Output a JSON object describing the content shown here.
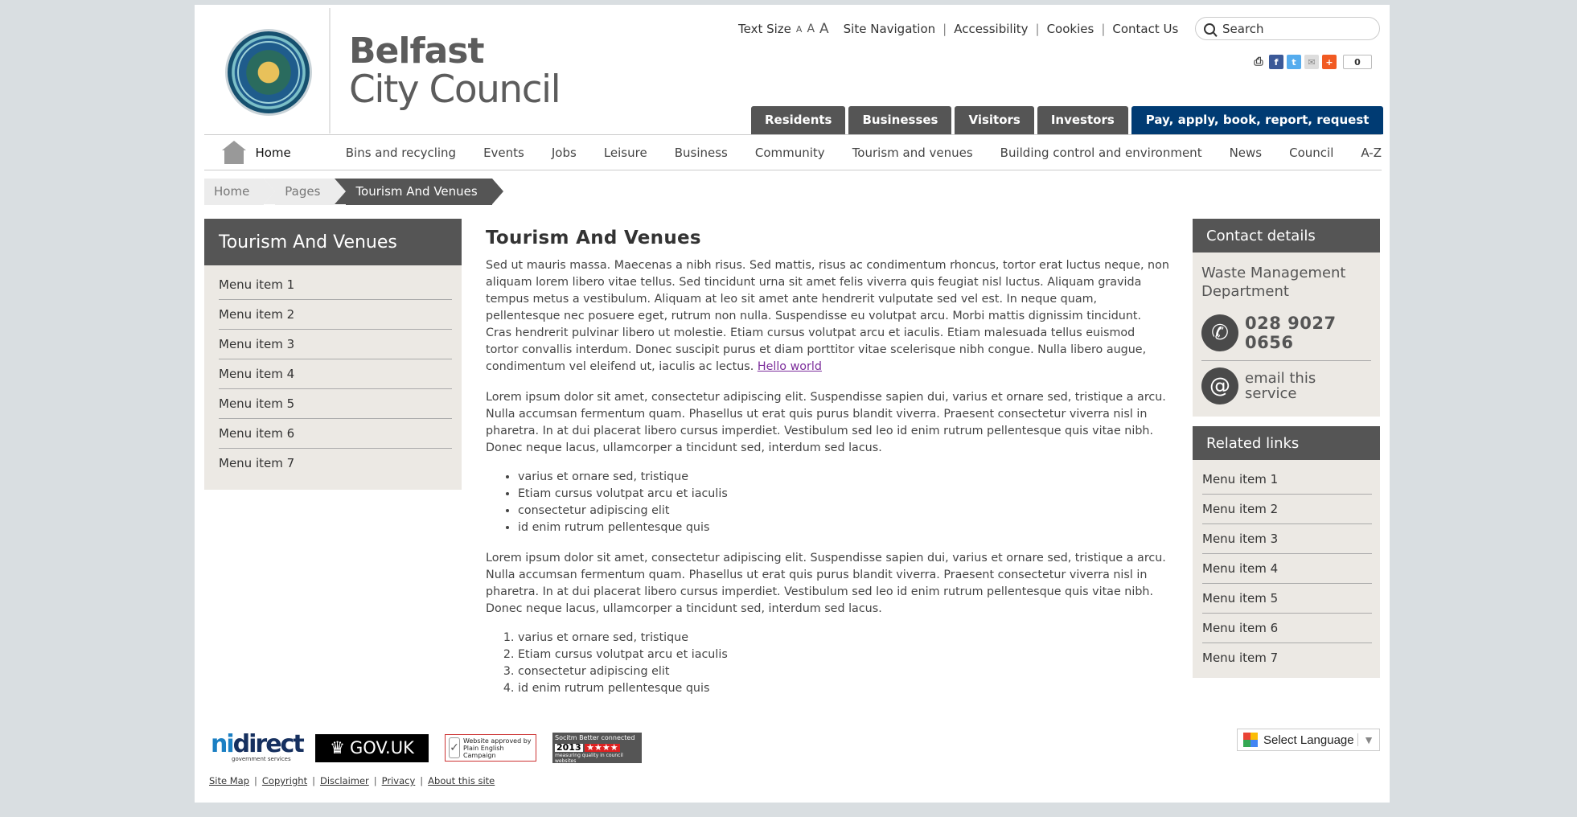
{
  "header": {
    "logo_line1": "Belfast",
    "logo_line2": "City Council",
    "text_size_label": "Text Size",
    "text_size_small": "A",
    "text_size_medium": "A",
    "text_size_large": "A",
    "utility_links": [
      "Site Navigation",
      "Accessibility",
      "Cookies",
      "Contact Us"
    ],
    "search_placeholder": "Search",
    "share_count": "0"
  },
  "audience_tabs": [
    "Residents",
    "Businesses",
    "Visitors",
    "Investors"
  ],
  "pay_tab": "Pay, apply, book, report, request",
  "main_nav": [
    "Home",
    "Bins and recycling",
    "Events",
    "Jobs",
    "Leisure",
    "Business",
    "Community",
    "Tourism and venues",
    "Building control and environment",
    "News",
    "Council",
    "A-Z"
  ],
  "breadcrumb": [
    "Home",
    "Pages",
    "Tourism And Venues"
  ],
  "left_nav": {
    "title": "Tourism And Venues",
    "items": [
      "Menu item 1",
      "Menu item 2",
      "Menu item 3",
      "Menu item 4",
      "Menu item 5",
      "Menu item 6",
      "Menu item 7"
    ]
  },
  "content": {
    "title": "Tourism And Venues",
    "p1": "Sed ut mauris massa. Maecenas a nibh risus. Sed mattis, risus ac condimentum rhoncus, tortor erat luctus neque, non aliquam lorem libero vitae tellus. Sed tincidunt urna sit amet felis viverra quis feugiat nisl luctus. Aliquam gravida tempus metus a vestibulum. Aliquam at leo sit amet ante hendrerit vulputate sed vel est. In neque quam, pellentesque nec posuere eget, rutrum non nulla. Suspendisse eu volutpat arcu. Morbi mattis dignissim tincidunt. Cras hendrerit pulvinar libero ut molestie. Etiam cursus volutpat arcu et iaculis. Etiam malesuada tellus euismod tortor convallis interdum. Donec suscipit purus et diam porttitor vitae scelerisque nibh congue. Nulla libero augue, condimentum vel eleifend ut, iaculis ac lectus.",
    "p1_link": "Hello world",
    "p2": "Lorem ipsum dolor sit amet, consectetur adipiscing elit. Suspendisse sapien dui, varius et ornare sed, tristique a arcu. Nulla accumsan fermentum quam. Phasellus ut erat quis purus blandit viverra. Praesent consectetur viverra nisl in pharetra. In at dui placerat libero cursus imperdiet. Vestibulum sed leo id enim rutrum pellentesque quis vitae nibh. Donec neque lacus, ullamcorper a tincidunt sed, interdum sed lacus.",
    "bullets": [
      "varius et ornare sed, tristique",
      "Etiam cursus volutpat arcu et iaculis",
      "consectetur adipiscing elit",
      "id enim rutrum pellentesque quis"
    ],
    "p3": "Lorem ipsum dolor sit amet, consectetur adipiscing elit. Suspendisse sapien dui, varius et ornare sed, tristique a arcu. Nulla accumsan fermentum quam. Phasellus ut erat quis purus blandit viverra. Praesent consectetur viverra nisl in pharetra. In at dui placerat libero cursus imperdiet. Vestibulum sed leo id enim rutrum pellentesque quis vitae nibh. Donec neque lacus, ullamcorper a tincidunt sed, interdum sed lacus.",
    "numbered": [
      "varius et ornare sed, tristique",
      "Etiam cursus volutpat arcu et iaculis",
      "consectetur adipiscing elit",
      "id enim rutrum pellentesque quis"
    ]
  },
  "contact": {
    "title": "Contact details",
    "department": "Waste Management Department",
    "phone": "028 9027 0656",
    "email_text": "email this service"
  },
  "related": {
    "title": "Related links",
    "items": [
      "Menu item 1",
      "Menu item 2",
      "Menu item 3",
      "Menu item 4",
      "Menu item 5",
      "Menu item 6",
      "Menu item 7"
    ]
  },
  "footer": {
    "nidirect_ni": "ni",
    "nidirect_rest": "direct",
    "nidirect_sub": "government services",
    "govuk": "GOV.UK",
    "plain_english": "Website approved by Plain English Campaign",
    "socitm_title": "Socitm Better connected",
    "socitm_year": "2013",
    "socitm_sub": "measuring quality in council websites",
    "language": "Select Language",
    "links": [
      "Site Map",
      "Copyright",
      "Disclaimer",
      "Privacy",
      "About this site"
    ]
  },
  "colors": {
    "page_bg": "#d9dee1",
    "dark_tab": "#555555",
    "pay_tab": "#003b73",
    "panel_bg": "#ece9e4",
    "link_visited": "#7c2d9b"
  }
}
